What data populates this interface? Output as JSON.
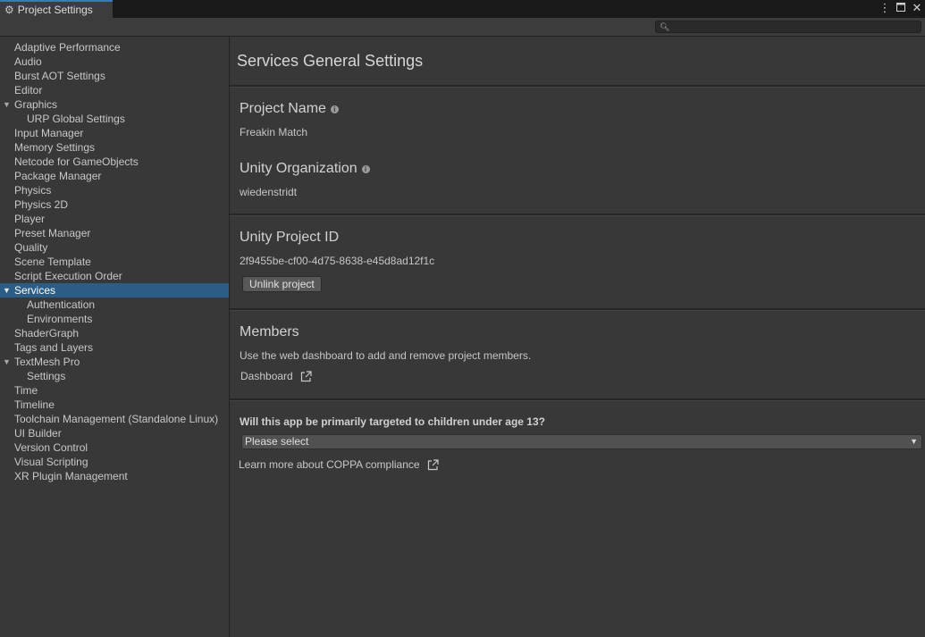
{
  "window": {
    "tab_title": "Project Settings",
    "tab_icon": "gear-icon",
    "menu_icon": "kebab-menu-icon",
    "maximize_icon": "maximize-icon",
    "close_icon": "close-icon"
  },
  "search": {
    "placeholder": "",
    "value": ""
  },
  "sidebar": {
    "items": [
      {
        "label": "Adaptive Performance"
      },
      {
        "label": "Audio"
      },
      {
        "label": "Burst AOT Settings"
      },
      {
        "label": "Editor"
      },
      {
        "label": "Graphics"
      },
      {
        "label": "URP Global Settings"
      },
      {
        "label": "Input Manager"
      },
      {
        "label": "Memory Settings"
      },
      {
        "label": "Netcode for GameObjects"
      },
      {
        "label": "Package Manager"
      },
      {
        "label": "Physics"
      },
      {
        "label": "Physics 2D"
      },
      {
        "label": "Player"
      },
      {
        "label": "Preset Manager"
      },
      {
        "label": "Quality"
      },
      {
        "label": "Scene Template"
      },
      {
        "label": "Script Execution Order"
      },
      {
        "label": "Services"
      },
      {
        "label": "Authentication"
      },
      {
        "label": "Environments"
      },
      {
        "label": "ShaderGraph"
      },
      {
        "label": "Tags and Layers"
      },
      {
        "label": "TextMesh Pro"
      },
      {
        "label": "Settings"
      },
      {
        "label": "Time"
      },
      {
        "label": "Timeline"
      },
      {
        "label": "Toolchain Management (Standalone Linux)"
      },
      {
        "label": "UI Builder"
      },
      {
        "label": "Version Control"
      },
      {
        "label": "Visual Scripting"
      },
      {
        "label": "XR Plugin Management"
      }
    ],
    "selected": "Services"
  },
  "main": {
    "title": "Services General Settings",
    "project_name": {
      "label": "Project Name",
      "value": "Freakin Match"
    },
    "organization": {
      "label": "Unity Organization",
      "value": "wiedenstridt"
    },
    "project_id": {
      "label": "Unity Project ID",
      "value": "2f9455be-cf00-4d75-8638-e45d8ad12f1c",
      "button": "Unlink project"
    },
    "members": {
      "label": "Members",
      "description": "Use the web dashboard to add and remove project members.",
      "link": "Dashboard"
    },
    "coppa": {
      "question": "Will this app be primarily targeted to children under age 13?",
      "selected": "Please select",
      "learn_more": "Learn more about COPPA compliance"
    }
  }
}
